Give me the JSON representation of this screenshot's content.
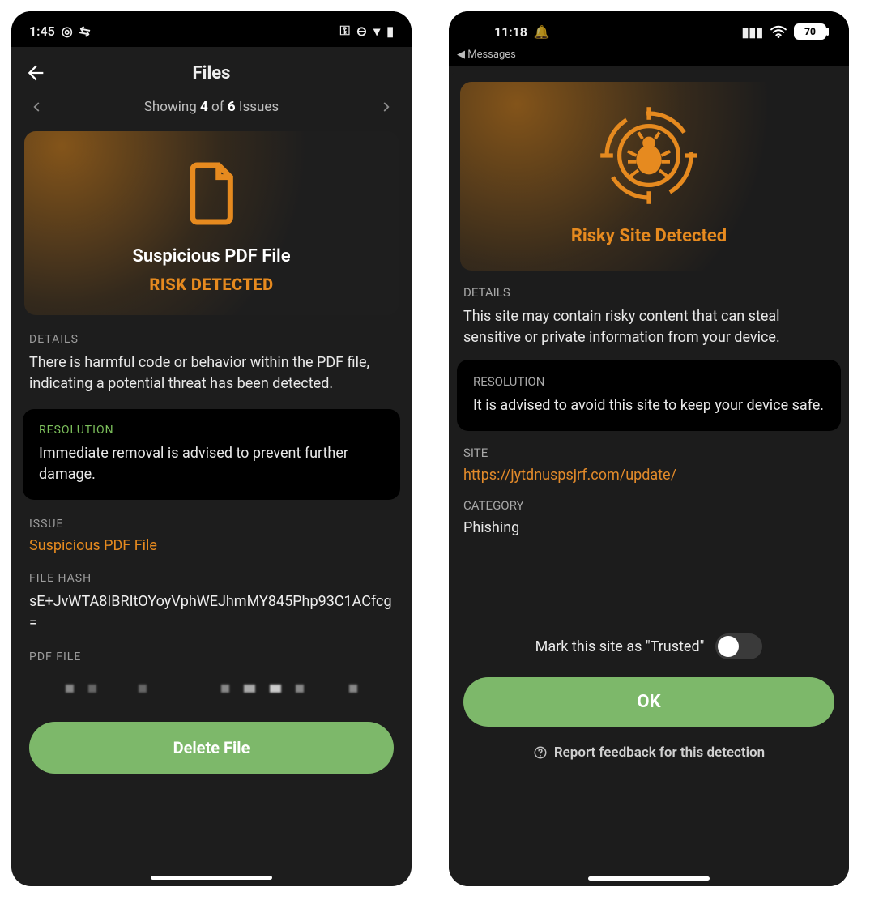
{
  "left": {
    "status": {
      "time": "1:45",
      "icons": [
        "mask",
        "wifi-alt",
        "vpn-key",
        "dnd",
        "wifi",
        "battery"
      ]
    },
    "header": {
      "title": "Files"
    },
    "issues_nav": {
      "prefix": "Showing ",
      "current": "4",
      "mid": " of ",
      "total": "6",
      "suffix": " Issues"
    },
    "threat": {
      "name": "Suspicious PDF File",
      "status": "RISK DETECTED"
    },
    "details": {
      "label": "DETAILS",
      "text": "There is harmful code or behavior within the PDF file, indicating a potential threat has been detected."
    },
    "resolution": {
      "label": "RESOLUTION",
      "text": "Immediate removal is advised to prevent further damage."
    },
    "issue": {
      "label": "ISSUE",
      "value": "Suspicious PDF File"
    },
    "hash": {
      "label": "FILE HASH",
      "value": "sE+JvWTA8IBRItOYoyVphWEJhmMY845Php93C1ACfcg="
    },
    "pdf_file": {
      "label": "PDF FILE"
    },
    "buttons": {
      "delete": "Delete File"
    }
  },
  "right": {
    "status": {
      "time": "11:18",
      "battery": "70"
    },
    "breadcrumb": "◀ Messages",
    "threat": {
      "title": "Risky Site Detected"
    },
    "details": {
      "label": "DETAILS",
      "text": "This site may contain risky content that can steal sensitive or private information from your device."
    },
    "resolution": {
      "label": "RESOLUTION",
      "text": "It is advised to avoid this site to keep your device safe."
    },
    "site": {
      "label": "SITE",
      "url": "https://jytdnuspsjrf.com/update/"
    },
    "category": {
      "label": "CATEGORY",
      "value": "Phishing"
    },
    "trusted": {
      "label": "Mark this site as \"Trusted\""
    },
    "buttons": {
      "ok": "OK"
    },
    "feedback": "Report feedback for this detection"
  }
}
